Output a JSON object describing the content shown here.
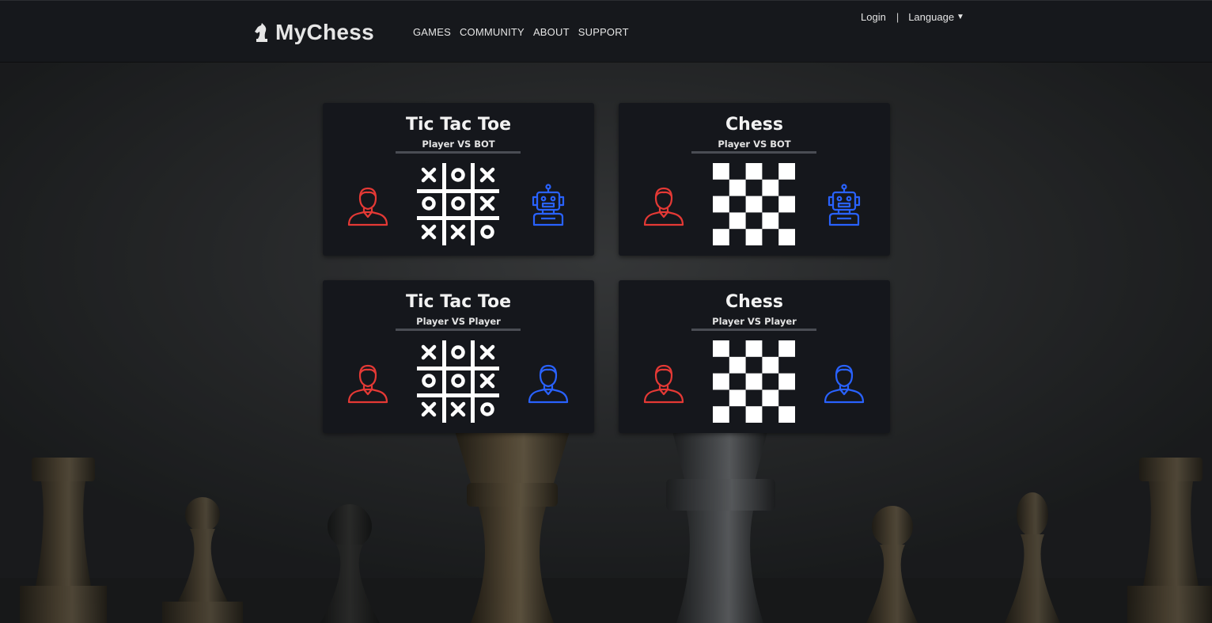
{
  "app": {
    "brand": "MyChess",
    "nav": [
      {
        "label": "GAMES"
      },
      {
        "label": "COMMUNITY"
      },
      {
        "label": "ABOUT"
      },
      {
        "label": "SUPPORT"
      }
    ],
    "login_label": "Login",
    "separator": "|",
    "language_label": "Language",
    "language_caret": "▼"
  },
  "cards": [
    {
      "title": "Tic Tac Toe",
      "subtitle": "Player VS BOT",
      "left_icon": "player-red-icon",
      "board_icon": "tic-tac-toe-icon",
      "right_icon": "robot-blue-icon"
    },
    {
      "title": "Chess",
      "subtitle": "Player VS BOT",
      "left_icon": "player-red-icon",
      "board_icon": "chessboard-icon",
      "right_icon": "robot-blue-icon"
    },
    {
      "title": "Tic Tac Toe",
      "subtitle": "Player VS Player",
      "left_icon": "player-red-icon",
      "board_icon": "tic-tac-toe-icon",
      "right_icon": "player-blue-icon"
    },
    {
      "title": "Chess",
      "subtitle": "Player VS Player",
      "left_icon": "player-red-icon",
      "board_icon": "chessboard-icon",
      "right_icon": "player-blue-icon"
    }
  ],
  "colors": {
    "header_bg": "#16181c",
    "card_bg": "#15171c",
    "player_red": "#e53935",
    "player_blue": "#2962ff",
    "text": "#f2f2f2"
  }
}
